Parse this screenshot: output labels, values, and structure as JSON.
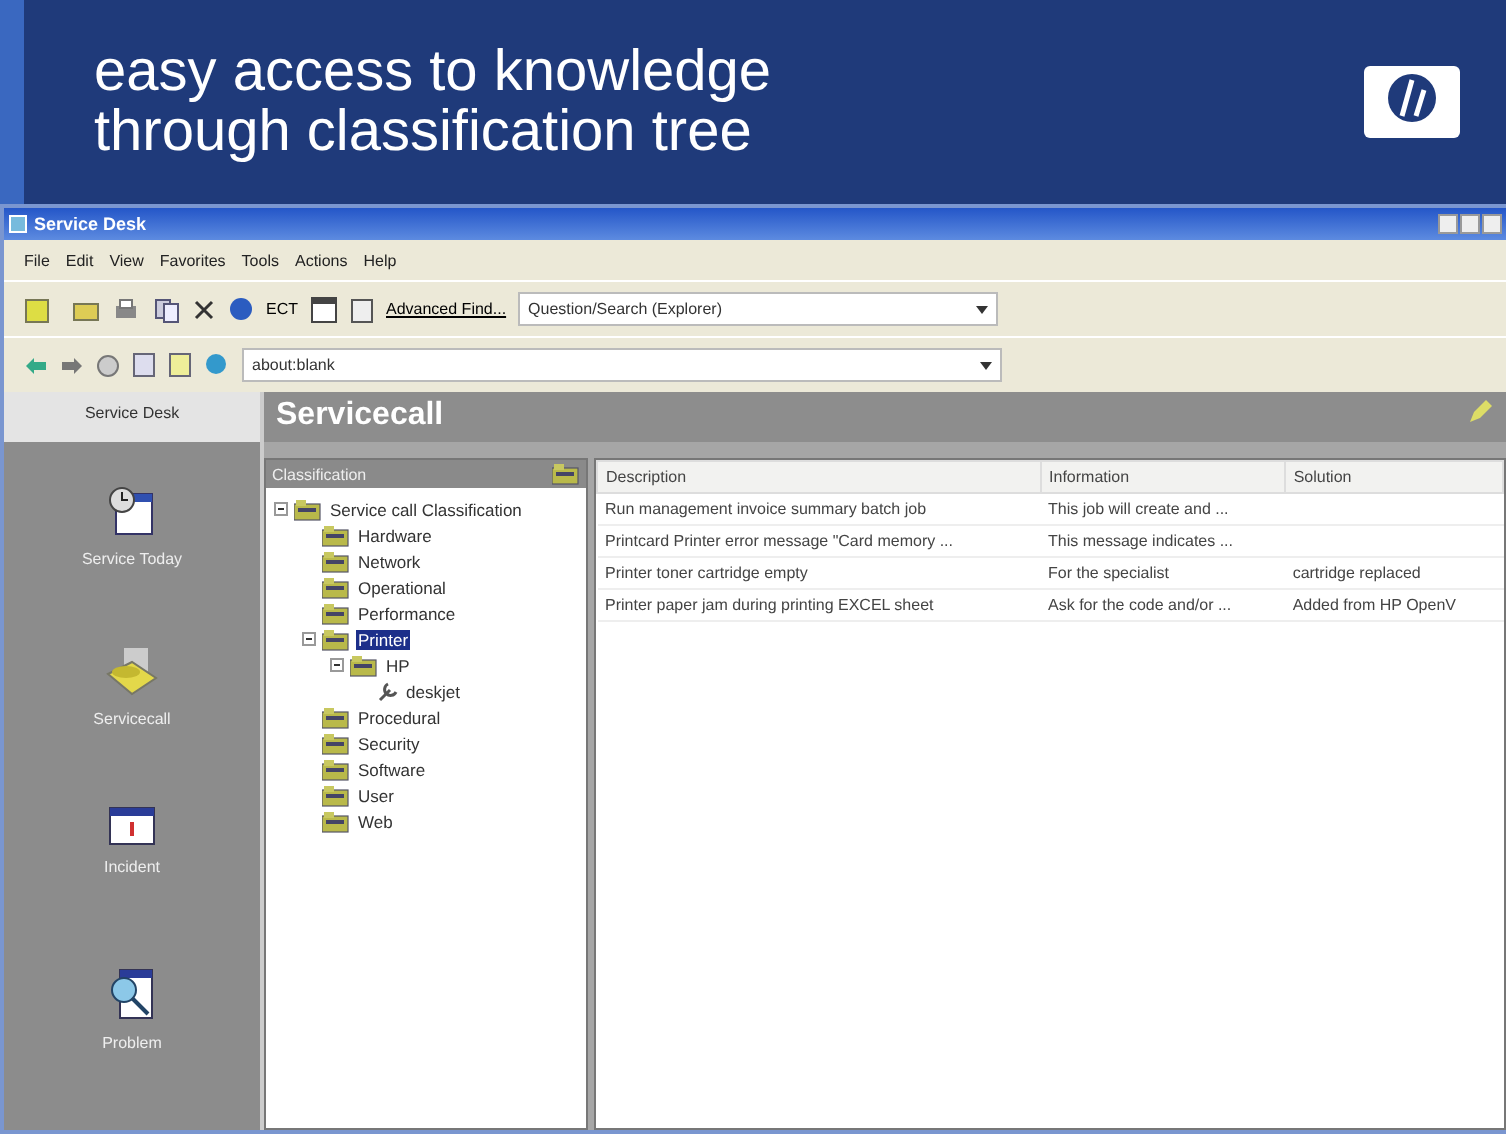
{
  "banner": {
    "title_lines": [
      "easy access to knowledge",
      "through classification tree"
    ]
  },
  "window": {
    "title": "Service Desk"
  },
  "menu": [
    "File",
    "Edit",
    "View",
    "Favorites",
    "Tools",
    "Actions",
    "Help"
  ],
  "toolbar": {
    "ect_label": "ECT",
    "advanced_find": "Advanced Find...",
    "find_value": "Question/Search (Explorer)",
    "address_value": "about:blank"
  },
  "nav": {
    "title": "Service Desk",
    "items": [
      {
        "label": "Service Today"
      },
      {
        "label": "Servicecall"
      },
      {
        "label": "Incident"
      },
      {
        "label": "Problem"
      }
    ]
  },
  "header": "Servicecall",
  "classification": {
    "title": "Classification",
    "tree": [
      {
        "label": "Service call Classification",
        "expanded": true,
        "selected": false,
        "children": [
          {
            "label": "Hardware",
            "selected": false
          },
          {
            "label": "Network",
            "selected": false
          },
          {
            "label": "Operational",
            "selected": false
          },
          {
            "label": "Performance",
            "selected": false
          },
          {
            "label": "Printer",
            "expanded": true,
            "selected": true,
            "children": [
              {
                "label": "HP",
                "expanded": true,
                "selected": false,
                "children": [
                  {
                    "label": "deskjet",
                    "selected": false,
                    "kind": "leaf"
                  }
                ]
              }
            ]
          },
          {
            "label": "Procedural",
            "selected": false
          },
          {
            "label": "Security",
            "selected": false
          },
          {
            "label": "Software",
            "selected": false
          },
          {
            "label": "User",
            "selected": false
          },
          {
            "label": "Web",
            "selected": false
          }
        ]
      }
    ]
  },
  "table": {
    "columns": [
      "Description",
      "Information",
      "Solution"
    ],
    "rows": [
      [
        "Run management invoice summary batch job",
        "This job will create and ...",
        ""
      ],
      [
        "Printcard Printer error message \"Card memory ...",
        "This message indicates ...",
        ""
      ],
      [
        "Printer toner cartridge empty",
        "For the specialist",
        "cartridge replaced"
      ],
      [
        "Printer paper jam during printing EXCEL sheet",
        "Ask for the code and/or ...",
        "Added from HP OpenV"
      ]
    ]
  }
}
